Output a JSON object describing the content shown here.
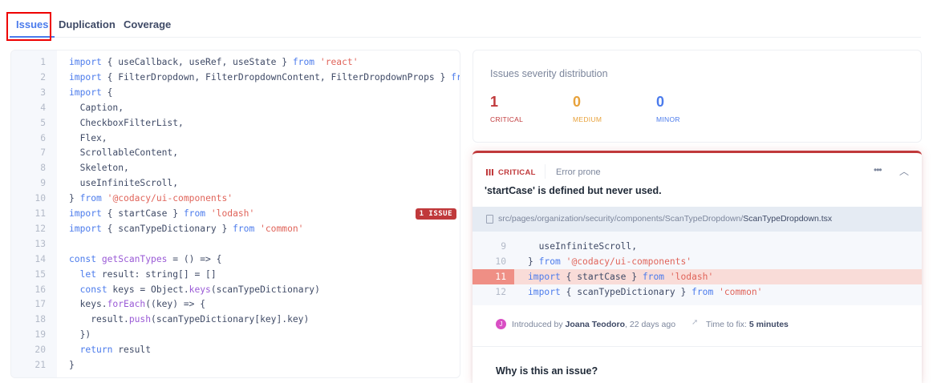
{
  "tabs": [
    {
      "label": "Issues",
      "active": true
    },
    {
      "label": "Duplication"
    },
    {
      "label": "Coverage"
    }
  ],
  "code": {
    "lines": [
      [
        [
          "k",
          "import"
        ],
        [
          "p",
          " { useCallback, useRef, useState } "
        ],
        [
          "k",
          "from"
        ],
        [
          "p",
          " "
        ],
        [
          "s",
          "'react'"
        ]
      ],
      [
        [
          "k",
          "import"
        ],
        [
          "p",
          " { FilterDropdown, FilterDropdownContent, FilterDropdownProps } "
        ],
        [
          "k",
          "from"
        ]
      ],
      [
        [
          "k",
          "import"
        ],
        [
          "p",
          " {"
        ]
      ],
      [
        [
          "p",
          "  Caption,"
        ]
      ],
      [
        [
          "p",
          "  CheckboxFilterList,"
        ]
      ],
      [
        [
          "p",
          "  Flex,"
        ]
      ],
      [
        [
          "p",
          "  ScrollableContent,"
        ]
      ],
      [
        [
          "p",
          "  Skeleton,"
        ]
      ],
      [
        [
          "p",
          "  useInfiniteScroll,"
        ]
      ],
      [
        [
          "p",
          "} "
        ],
        [
          "k",
          "from"
        ],
        [
          "p",
          " "
        ],
        [
          "s",
          "'@codacy/ui-components'"
        ]
      ],
      [
        [
          "k",
          "import"
        ],
        [
          "p",
          " { startCase } "
        ],
        [
          "k",
          "from"
        ],
        [
          "p",
          " "
        ],
        [
          "s",
          "'lodash'"
        ]
      ],
      [
        [
          "k",
          "import"
        ],
        [
          "p",
          " { scanTypeDictionary } "
        ],
        [
          "k",
          "from"
        ],
        [
          "p",
          " "
        ],
        [
          "s",
          "'common'"
        ]
      ],
      [],
      [
        [
          "k",
          "const"
        ],
        [
          "p",
          " "
        ],
        [
          "f",
          "getScanTypes"
        ],
        [
          "p",
          " = () => {"
        ]
      ],
      [
        [
          "p",
          "  "
        ],
        [
          "k",
          "let"
        ],
        [
          "p",
          " result: string[] = []"
        ]
      ],
      [
        [
          "p",
          "  "
        ],
        [
          "k",
          "const"
        ],
        [
          "p",
          " keys = Object."
        ],
        [
          "f",
          "keys"
        ],
        [
          "p",
          "(scanTypeDictionary)"
        ]
      ],
      [
        [
          "p",
          "  keys."
        ],
        [
          "f",
          "forEach"
        ],
        [
          "p",
          "((key) => {"
        ]
      ],
      [
        [
          "p",
          "    result."
        ],
        [
          "f",
          "push"
        ],
        [
          "p",
          "(scanTypeDictionary[key].key)"
        ]
      ],
      [
        [
          "p",
          "  })"
        ]
      ],
      [
        [
          "p",
          "  "
        ],
        [
          "k",
          "return"
        ],
        [
          "p",
          " result"
        ]
      ],
      [
        [
          "p",
          "}"
        ]
      ]
    ],
    "issue_line": 11,
    "issue_badge": "1 ISSUE"
  },
  "severity": {
    "title": "Issues severity distribution",
    "items": [
      {
        "count": "1",
        "label": "CRITICAL",
        "color": "#c0393b"
      },
      {
        "count": "0",
        "label": "MEDIUM",
        "color": "#e8a23b"
      },
      {
        "count": "0",
        "label": "MINOR",
        "color": "#4b7bec"
      }
    ]
  },
  "issue": {
    "severity": "CRITICAL",
    "category": "Error prone",
    "more_icon": "ellipsis-icon",
    "collapse_icon": "chevron-up-icon",
    "message": "'startCase' is defined but never used.",
    "path_prefix": "src/pages/organization/security/components/ScanTypeDropdown/",
    "path_file": "ScanTypeDropdown.tsx",
    "snippet": [
      {
        "n": "9",
        "tokens": [
          [
            "p",
            "  useInfiniteScroll,"
          ]
        ]
      },
      {
        "n": "10",
        "tokens": [
          [
            "p",
            "} "
          ],
          [
            "k",
            "from"
          ],
          [
            "p",
            " "
          ],
          [
            "s",
            "'@codacy/ui-components'"
          ]
        ]
      },
      {
        "n": "11",
        "hl": true,
        "tokens": [
          [
            "k",
            "import"
          ],
          [
            "p",
            " { startCase } "
          ],
          [
            "k",
            "from"
          ],
          [
            "p",
            " "
          ],
          [
            "s",
            "'lodash'"
          ]
        ]
      },
      {
        "n": "12",
        "tokens": [
          [
            "k",
            "import"
          ],
          [
            "p",
            " { scanTypeDictionary } "
          ],
          [
            "k",
            "from"
          ],
          [
            "p",
            " "
          ],
          [
            "s",
            "'common'"
          ]
        ]
      }
    ],
    "introduced_prefix": "Introduced by ",
    "author": "Joana Teodoro",
    "when": ", 22 days ago",
    "ttf_label": "Time to fix: ",
    "ttf_value": "5 minutes",
    "why_title": "Why is this an issue?"
  }
}
